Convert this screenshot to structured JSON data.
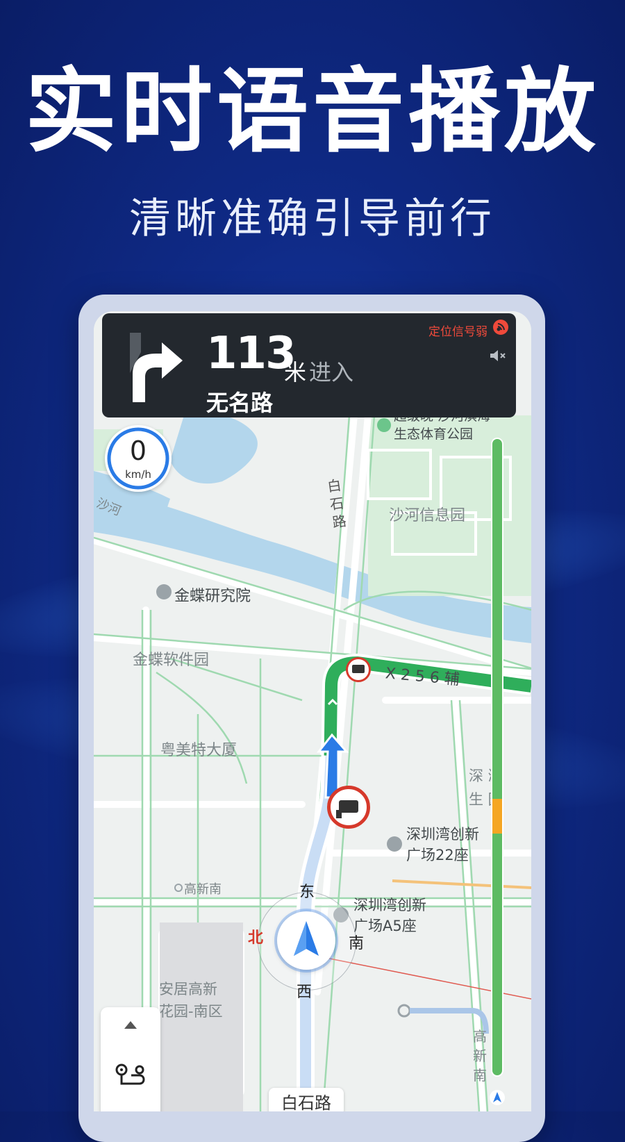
{
  "promo": {
    "headline": "实时语音播放",
    "subline": "清晰准确引导前行"
  },
  "nav": {
    "turn_direction": "right",
    "distance": "113",
    "distance_unit": "米",
    "action": "进入",
    "road_name": "无名路",
    "gps_status": "定位信号弱",
    "sound": "muted"
  },
  "speed": {
    "value": "0",
    "unit": "km/h"
  },
  "map": {
    "labels": {
      "park": "超级晚·沙河滨海\n生态体育公园",
      "baishi_road_vertical": "白石路",
      "shahe": "沙河",
      "shahe_info_park": "沙河信息园",
      "kingdee_institute": "金蝶研究院",
      "kingdee_park": "金蝶软件园",
      "yuemeite": "粤美特大厦",
      "route_road": "X 2 5 6 辅",
      "shenzhen_bay_partial": "深 湾\n生 园",
      "plaza_22": "深圳湾创新\n广场22座",
      "gaoxinnan": "高新南",
      "plaza_a5": "深圳湾创新\n广场A5座",
      "anju": "安居高新\n花园-南区",
      "gaoxin_vertical": "高\n新\n南",
      "bottom_road": "白石路"
    },
    "compass": {
      "east": "东",
      "south": "南",
      "west": "西",
      "north": "北"
    }
  },
  "traffic_bar": {
    "colors": {
      "clear": "#5dbb63",
      "slow": "#f5a623"
    }
  },
  "colors": {
    "route": "#2fae5b",
    "camera_ring": "#d6392b",
    "car_arrow": "#2a7be6"
  }
}
